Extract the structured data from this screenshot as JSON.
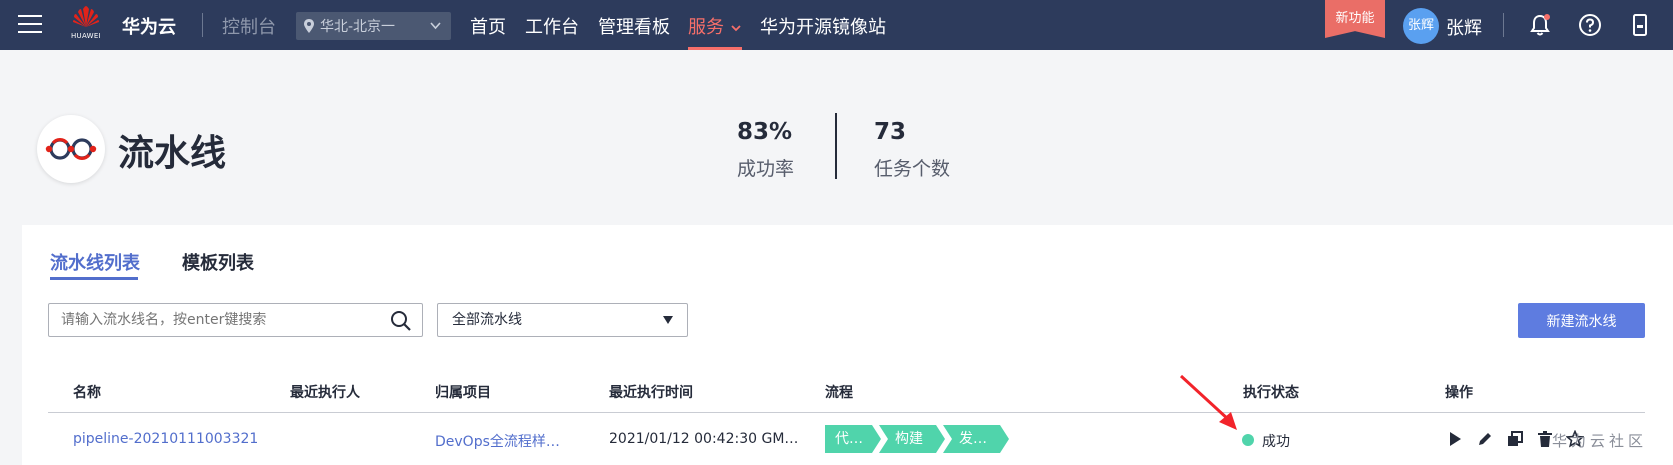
{
  "topbar": {
    "logo_text": "HUAWEI",
    "brand": "华为云",
    "console": "控制台",
    "region": "华北-北京一",
    "nav": [
      "首页",
      "工作台",
      "管理看板",
      "服务",
      "华为开源镜像站"
    ],
    "new_feature": "新功能",
    "avatar_text": "张辉",
    "username": "张辉"
  },
  "header": {
    "title": "流水线",
    "stats": [
      {
        "value": "83%",
        "label": "成功率"
      },
      {
        "value": "73",
        "label": "任务个数"
      }
    ]
  },
  "tabs": [
    "流水线列表",
    "模板列表"
  ],
  "toolbar": {
    "search_placeholder": "请输入流水线名，按enter键搜索",
    "filter_value": "全部流水线",
    "new_button": "新建流水线"
  },
  "table": {
    "columns": [
      "名称",
      "最近执行人",
      "归属项目",
      "最近执行时间",
      "流程",
      "执行状态",
      "操作"
    ],
    "rows": [
      {
        "name": "pipeline-20210111003321",
        "executor": "",
        "project": "DevOps全流程样…",
        "time": "2021/01/12 00:42:30 GM…",
        "flow": [
          "代…",
          "构建",
          "发…"
        ],
        "status": "成功"
      }
    ]
  },
  "watermark": "华为云社区",
  "colors": {
    "topbar": "#2d3b5c",
    "accent": "#526ecc",
    "active_nav": "#f66f6a",
    "success": "#50d4ab",
    "primary_button": "#5e7ce0"
  }
}
